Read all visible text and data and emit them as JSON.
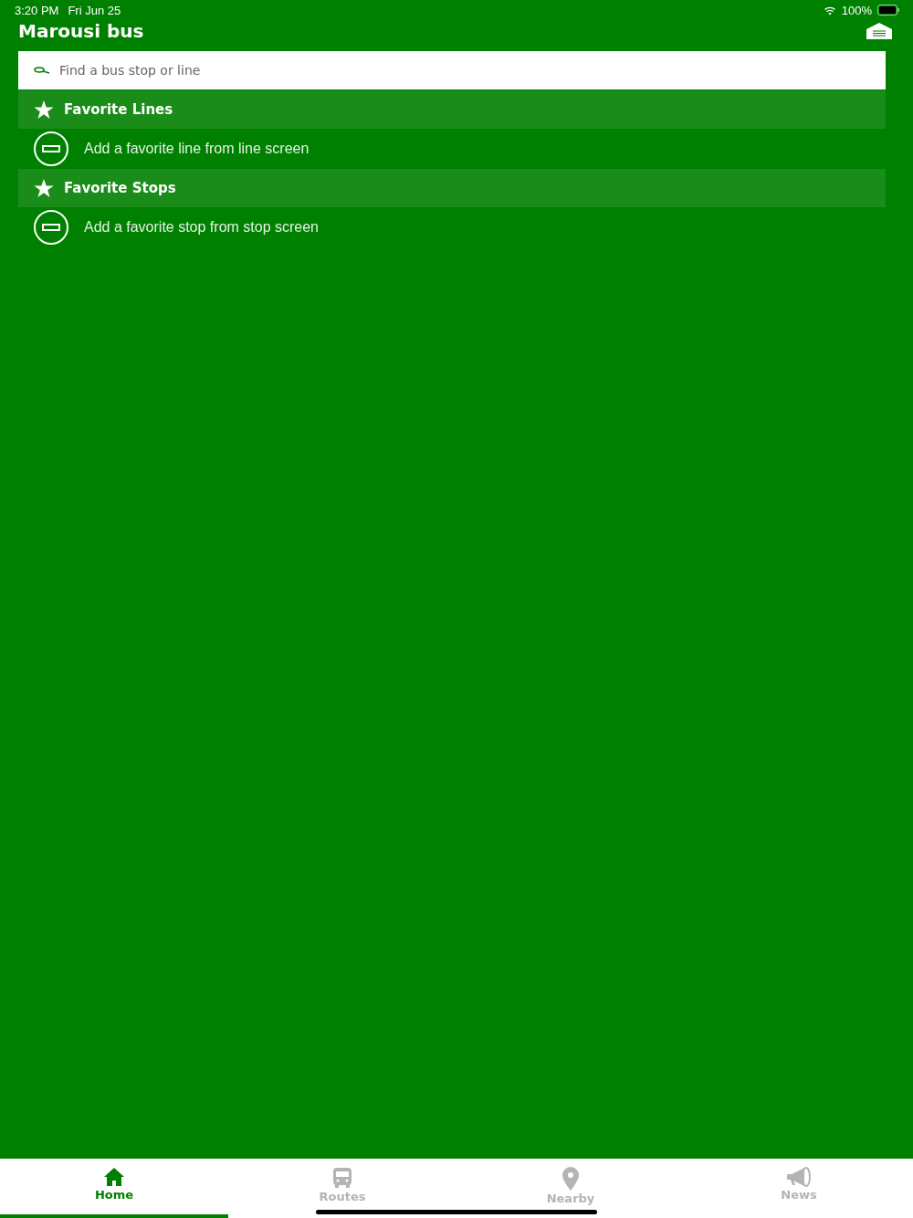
{
  "status_bar": {
    "time": "3:20 PM",
    "date": "Fri Jun 25",
    "battery": "100%"
  },
  "header": {
    "title": "Marousi bus"
  },
  "search": {
    "placeholder": "Find a bus stop or line"
  },
  "sections": [
    {
      "title": "Favorite Lines",
      "empty_text": "Add a favorite line from line screen"
    },
    {
      "title": "Favorite Stops",
      "empty_text": "Add a favorite stop from stop screen"
    }
  ],
  "tabs": [
    {
      "kind": "home",
      "label": "Home",
      "selected": true
    },
    {
      "kind": "routes",
      "label": "Routes",
      "selected": false
    },
    {
      "kind": "nearby",
      "label": "Nearby",
      "selected": false
    },
    {
      "kind": "news",
      "label": "News",
      "selected": false
    }
  ]
}
